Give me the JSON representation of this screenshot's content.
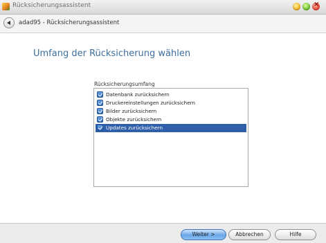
{
  "window": {
    "title": "Rücksicherungsassistent"
  },
  "nav": {
    "path": "adad95 - Rücksicherungsassistent"
  },
  "main": {
    "heading": "Umfang der Rücksicherung wählen",
    "group_label": "Rücksicherungsumfang",
    "items": [
      {
        "label": "Datenbank zurücksichern",
        "checked": true,
        "selected": false
      },
      {
        "label": "Druckereinstellungen zurücksichern",
        "checked": true,
        "selected": false
      },
      {
        "label": "Bilder zurücksichern",
        "checked": true,
        "selected": false
      },
      {
        "label": "Objekte zurücksichern",
        "checked": true,
        "selected": false
      },
      {
        "label": "Updates zurücksichern",
        "checked": true,
        "selected": true
      }
    ]
  },
  "buttons": {
    "next": "Weiter >",
    "cancel": "Abbrechen",
    "help": "Hilfe"
  },
  "colors": {
    "heading": "#3d6e9c",
    "selection": "#2f5fa8",
    "checkbox": "#2d68b5"
  },
  "icons": {
    "back": "back-arrow-icon",
    "app": "app-icon"
  }
}
